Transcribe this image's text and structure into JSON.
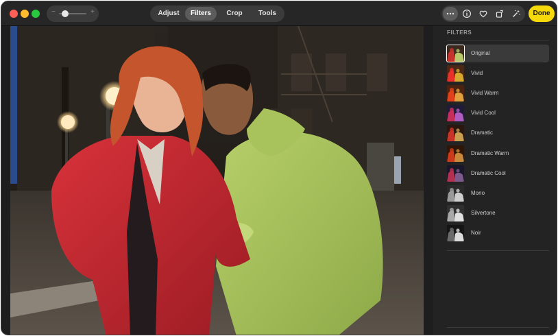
{
  "toolbar": {
    "zoom": {
      "minus": "−",
      "plus": "+",
      "level": 0.2
    },
    "segments": [
      {
        "label": "Adjust",
        "active": false
      },
      {
        "label": "Filters",
        "active": true
      },
      {
        "label": "Crop",
        "active": false
      },
      {
        "label": "Tools",
        "active": false
      }
    ],
    "icons": [
      "more-icon",
      "info-icon",
      "heart-icon",
      "rotate-icon",
      "auto-enhance-icon"
    ],
    "done_label": "Done",
    "done_color": "#f5d90a"
  },
  "filters": {
    "title": "FILTERS",
    "selected": "Original",
    "items": [
      {
        "label": "Original",
        "tone": "original"
      },
      {
        "label": "Vivid",
        "tone": "vivid"
      },
      {
        "label": "Vivid Warm",
        "tone": "warm"
      },
      {
        "label": "Vivid Cool",
        "tone": "cool"
      },
      {
        "label": "Dramatic",
        "tone": "dramatic"
      },
      {
        "label": "Dramatic Warm",
        "tone": "dramatic-warm"
      },
      {
        "label": "Dramatic Cool",
        "tone": "dramatic-cool"
      },
      {
        "label": "Mono",
        "tone": "mono"
      },
      {
        "label": "Silvertone",
        "tone": "silver"
      },
      {
        "label": "Noir",
        "tone": "noir"
      }
    ]
  }
}
